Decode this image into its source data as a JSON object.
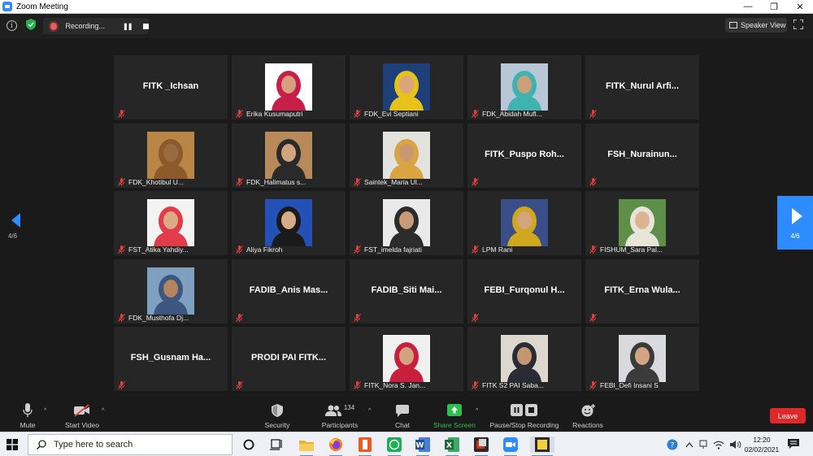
{
  "window": {
    "title": "Zoom Meeting",
    "minimize": "—",
    "restore": "❐",
    "close": "✕"
  },
  "top": {
    "info_icon": "info-icon",
    "encryption_icon": "green-shield-icon",
    "recording_label": "Recording...",
    "pause_glyph": "❚❚",
    "speaker_view_label": "Speaker View",
    "fullscreen_icon": "fullscreen-icon"
  },
  "grid": {
    "page_indicator": "4/6",
    "participants": [
      {
        "name": "FITK _Ichsan",
        "video": false,
        "muted": true
      },
      {
        "name": "Erika Kusumaputri",
        "video": true,
        "muted": true,
        "skin": "#d6a07e",
        "top": "#c81e4a",
        "bg": "#ffffff"
      },
      {
        "name": "FDK_Evi Septiani",
        "video": true,
        "muted": true,
        "skin": "#d9a57f",
        "top": "#e6c21b",
        "bg": "#1f3f78"
      },
      {
        "name": "FDK_Abidah Mufl...",
        "video": true,
        "muted": true,
        "skin": "#caa07a",
        "top": "#3fb3b0",
        "bg": "#b7c7d5"
      },
      {
        "name": "FITK_Nurul  Arfi...",
        "video": false,
        "muted": true
      },
      {
        "name": "FDK_Khotibul U...",
        "video": true,
        "muted": true,
        "skin": "#9a6b3f",
        "top": "#8c5a2b",
        "bg": "#b98648"
      },
      {
        "name": "FDK_Halimatus s...",
        "video": true,
        "muted": true,
        "skin": "#d2a47e",
        "top": "#2a2a2a",
        "bg": "#b88a5a"
      },
      {
        "name": "Saintek_Maria Ul...",
        "video": true,
        "muted": true,
        "skin": "#c89872",
        "top": "#d9a441",
        "bg": "#e2e2de"
      },
      {
        "name": "FITK_Puspo  Roh...",
        "video": false,
        "muted": true
      },
      {
        "name": "FSH_Nurainun...",
        "video": false,
        "muted": true
      },
      {
        "name": "FST_Atika Yahdiy...",
        "video": true,
        "muted": true,
        "skin": "#dcaa84",
        "top": "#e23b4a",
        "bg": "#f3f3f3"
      },
      {
        "name": "Aliya Fikroh",
        "video": true,
        "muted": true,
        "skin": "#d8ab88",
        "top": "#1a1a1a",
        "bg": "#2451b5"
      },
      {
        "name": "FST_imelda fajriati",
        "video": true,
        "muted": true,
        "skin": "#c79a78",
        "top": "#2c2c2c",
        "bg": "#e9e9e9"
      },
      {
        "name": "LPM Rani",
        "video": true,
        "muted": true,
        "skin": "#d3a47d",
        "top": "#d0a81e",
        "bg": "#3a4e8a"
      },
      {
        "name": "FISHUM_Sara Pal...",
        "video": true,
        "muted": true,
        "skin": "#ddb493",
        "top": "#e8e4da",
        "bg": "#5e8f48"
      },
      {
        "name": "FDK_Musthofa Dj...",
        "video": true,
        "muted": true,
        "skin": "#b58460",
        "top": "#3d5680",
        "bg": "#7fa0c0"
      },
      {
        "name": "FADIB_Anis  Mas...",
        "video": false,
        "muted": true
      },
      {
        "name": "FADIB_Siti  Mai...",
        "video": false,
        "muted": true
      },
      {
        "name": "FEBI_Furqonul  H...",
        "video": false,
        "muted": true
      },
      {
        "name": "FITK_Erna  Wula...",
        "video": false,
        "muted": true
      },
      {
        "name": "FSH_Gusnam  Ha...",
        "video": false,
        "muted": true
      },
      {
        "name": "PRODI PAI FITK...",
        "video": false,
        "muted": true
      },
      {
        "name": "FITK_Nora S. Jan...",
        "video": true,
        "muted": true,
        "skin": "#d3a37f",
        "top": "#c8203c",
        "bg": "#f0f0f0"
      },
      {
        "name": "FITK S2 PAI Saba...",
        "video": true,
        "muted": true,
        "skin": "#c59672",
        "top": "#2b2b36",
        "bg": "#ddd8cf"
      },
      {
        "name": "FEBI_Defi Insani S",
        "video": true,
        "muted": true,
        "skin": "#d4a582",
        "top": "#3b3b3b",
        "bg": "#d9dadd"
      }
    ]
  },
  "toolbar": {
    "mute": "Mute",
    "start_video": "Start Video",
    "security": "Security",
    "participants": "Participants",
    "participants_count": "134",
    "chat": "Chat",
    "share_screen": "Share Screen",
    "pause_recording": "Pause/Stop Recording",
    "reactions": "Reactions",
    "leave": "Leave",
    "caret": "^"
  },
  "colors": {
    "zoom_blue": "#2d8cff",
    "share_green": "#2fbf4f",
    "leave_red": "#e02828",
    "mute_red": "#e0413a"
  },
  "taskbar": {
    "search_placeholder": "Type here to search",
    "apps": [
      "task-view",
      "file-explorer",
      "firefox",
      "office",
      "whatsapp",
      "word",
      "excel",
      "adobe-reader",
      "zoom",
      "sticky-notes"
    ],
    "time": "12:20",
    "date": "02/02/2021",
    "tray_icons": [
      "help-icon",
      "chevron-up-icon",
      "network-icon",
      "wifi-icon",
      "volume-icon"
    ]
  }
}
